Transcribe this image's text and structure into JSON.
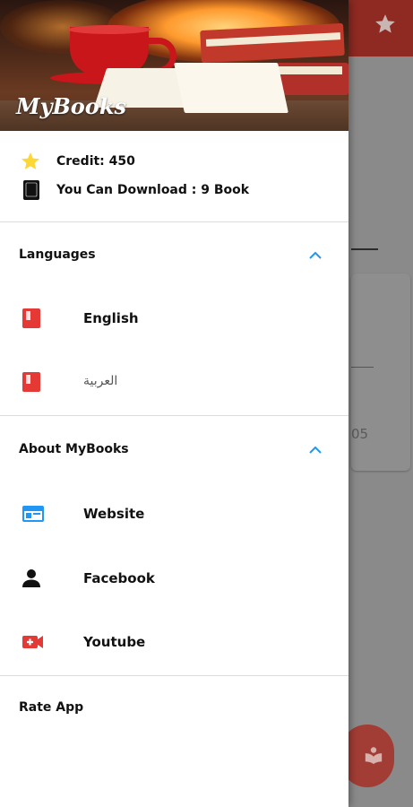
{
  "background": {
    "topbar_color": "#8e2a22",
    "star_icon": "star-icon",
    "partial_number": "05",
    "fab_icon": "read-book-icon"
  },
  "drawer": {
    "header": {
      "logo_text": "MyBooks"
    },
    "account": {
      "credit_label": "Credit: 450",
      "credit_icon": "star-icon",
      "download_label": "You Can Download : 9 Book",
      "download_icon": "book-icon"
    },
    "languages": {
      "title": "Languages",
      "expanded": true,
      "items": [
        {
          "label": "English",
          "icon": "book-icon",
          "selected": true
        },
        {
          "label": "العربية",
          "icon": "book-icon",
          "selected": false
        }
      ]
    },
    "about": {
      "title": "About MyBooks",
      "expanded": true,
      "items": [
        {
          "label": "Website",
          "icon": "web-icon"
        },
        {
          "label": "Facebook",
          "icon": "person-icon"
        },
        {
          "label": "Youtube",
          "icon": "video-icon"
        }
      ]
    },
    "rate_app": {
      "label": "Rate App"
    },
    "colors": {
      "accent_red": "#e53935",
      "accent_blue": "#2196f3",
      "star_yellow": "#fdd835"
    }
  }
}
